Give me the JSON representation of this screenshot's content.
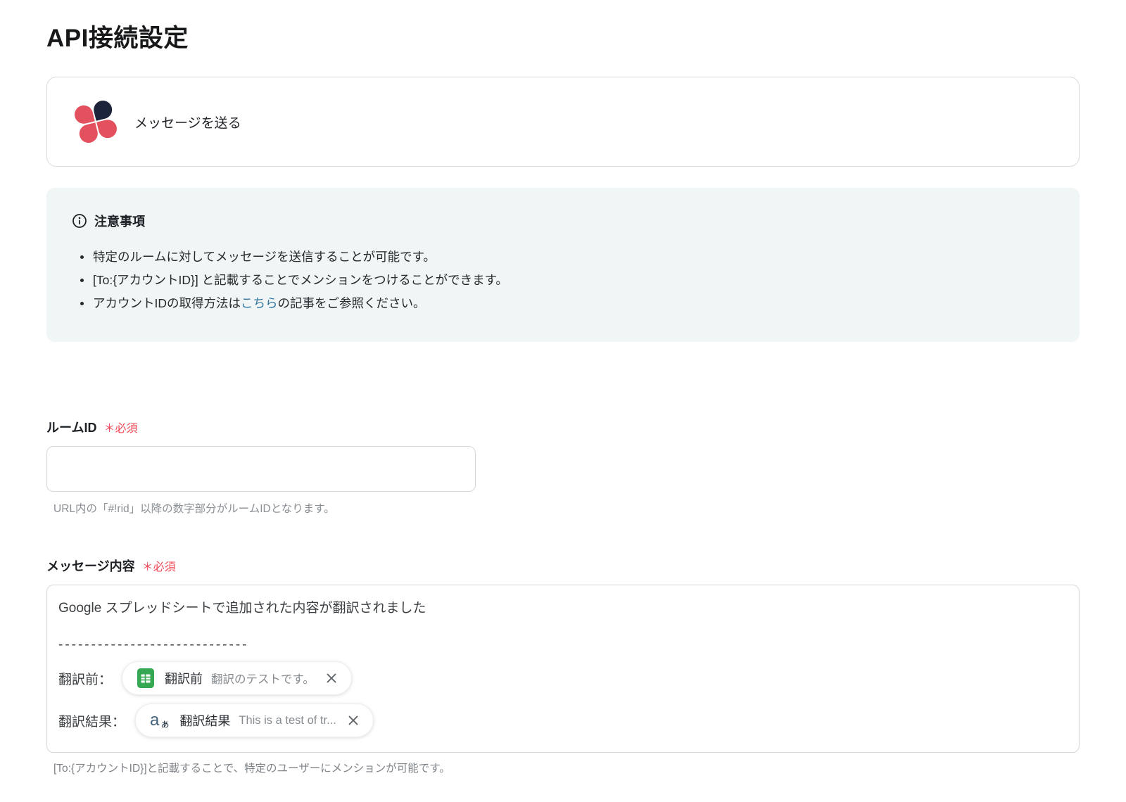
{
  "page": {
    "title": "API接続設定"
  },
  "app_card": {
    "name": "メッセージを送る"
  },
  "notice": {
    "title": "注意事項",
    "bullet1": "特定のルームに対してメッセージを送信することが可能です。",
    "bullet2": "[To:{アカウントID}] と記載することでメンションをつけることができます。",
    "bullet3_pre": "アカウントIDの取得方法は",
    "bullet3_link": "こちら",
    "bullet3_post": "の記事をご参照ください。"
  },
  "fields": {
    "room_id": {
      "label": "ルームID",
      "required": "＊必須",
      "value": "",
      "helper": "URL内の「#!rid」以降の数字部分がルームIDとなります。"
    },
    "message": {
      "label": "メッセージ内容",
      "required": "＊必須",
      "line1": "Google スプレッドシートで追加された内容が翻訳されました",
      "divider": "-----------------------------",
      "row1_label": "翻訳前：",
      "row2_label": "翻訳結果：",
      "chip1": {
        "name": "翻訳前",
        "value": "翻訳のテストです。"
      },
      "chip2": {
        "icon_main": "a",
        "icon_sub": "ぁ",
        "name": "翻訳結果",
        "value": "This is a test of tr..."
      },
      "helper": "[To:{アカウントID}]と記載することで、特定のユーザーにメンションが可能です。"
    }
  },
  "colors": {
    "logo_red": "#e3505e",
    "logo_navy": "#1d2439",
    "notice_bg": "#f0f5f5",
    "link_blue": "#35789f",
    "required_red": "#f04a56",
    "sheets_green": "#34a853"
  }
}
